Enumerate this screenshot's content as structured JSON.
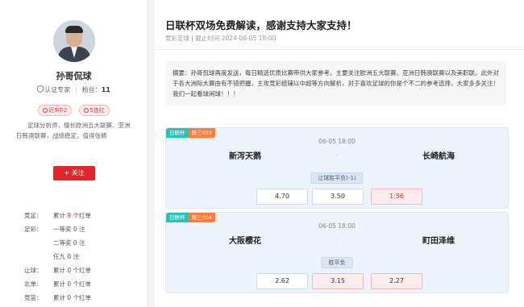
{
  "profile": {
    "name": "孙哥侃球",
    "cert": "认证专家",
    "fans_label": "粉丝：",
    "fans_count": "11",
    "badges": [
      "近9中2",
      "5连红"
    ],
    "bio": "足球分析师，擅长欧洲五大联赛、亚洲日韩澳联赛，战绩稳定，值得信赖",
    "follow_label": "+ 关注",
    "stats": [
      {
        "k": "竞足：",
        "pre": "累计",
        "num": "9",
        "post": "个红单"
      },
      {
        "k": "足彩：",
        "pre": "一等奖",
        "num": "0",
        "post": "注"
      },
      {
        "k": "",
        "pre": "二等奖",
        "num": "0",
        "post": "注"
      },
      {
        "k": "",
        "pre": "任九",
        "num": "0",
        "post": "注"
      },
      {
        "k": "让球：",
        "pre": "累计",
        "num": "0",
        "post": "个红单"
      },
      {
        "k": "北单：",
        "pre": "累计",
        "num": "0",
        "post": "个红单"
      },
      {
        "k": "竞篮：",
        "pre": "累计",
        "num": "0",
        "post": "个红单"
      }
    ]
  },
  "article": {
    "title": "日联杯双场免费解读，感谢支持大家支持！",
    "category": "竞彩足球",
    "deadline": "截止时间 2024-06-05 18:00",
    "abstract": "摘要：孙哥侃球再度发送，每日精选优质比赛带供大家参考。主要关注欧洲五大联赛、亚洲日韩澳联赛以及美职联。此外对于各大洲际大赛由有不错把握，主攻竞彩统辅以中超等方向解析，对于喜欢足球的你是个不二的参考选择，大家多多关注！我们一起看球闹球！！！"
  },
  "matches": [
    {
      "league": "日联杯",
      "week_no": "周三003",
      "home": "新泻天鹅",
      "away": "长崎航海",
      "time": "06-05 18:00",
      "vs": "-",
      "market": "让球胜平负(-1)",
      "odds": [
        "4.70",
        "3.50",
        "1.56"
      ],
      "picked": [
        false,
        false,
        true
      ]
    },
    {
      "league": "日联杯",
      "week_no": "周三004",
      "home": "大阪樱花",
      "away": "町田泽维",
      "time": "06-05 18:00",
      "vs": "-",
      "market": "胜平负",
      "odds": [
        "2.62",
        "3.15",
        "2.27"
      ],
      "picked": [
        false,
        true,
        true
      ]
    }
  ],
  "colors": {
    "accent": "#e0262c",
    "league_tag": "#2cc1b5",
    "week_tag": "#ff7a3d",
    "card_bg": "#edf3fb"
  }
}
